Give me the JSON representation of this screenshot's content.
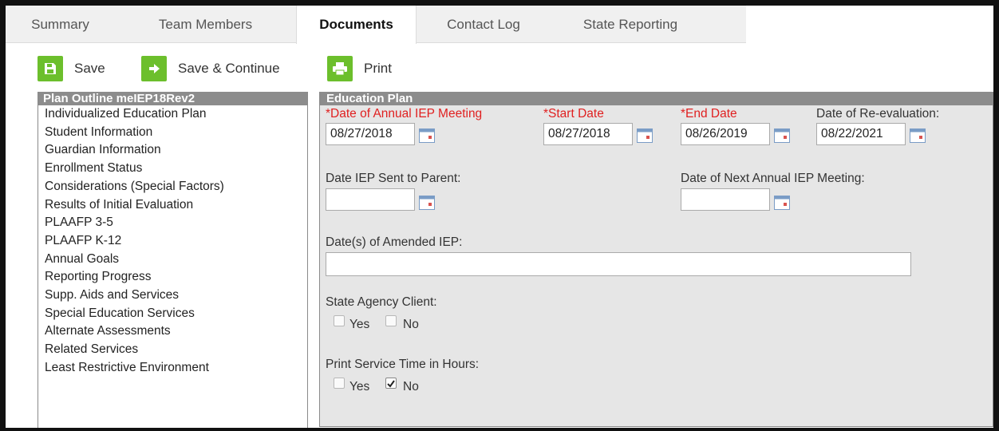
{
  "tabs": [
    {
      "label": "Summary"
    },
    {
      "label": "Team Members"
    },
    {
      "label": "Documents"
    },
    {
      "label": "Contact Log"
    },
    {
      "label": "State Reporting"
    }
  ],
  "active_tab": "Documents",
  "toolbar": {
    "save_label": "Save",
    "save_continue_label": "Save & Continue",
    "print_label": "Print"
  },
  "outline": {
    "title": "Plan Outline meIEP18Rev2",
    "items": [
      "Individualized Education Plan",
      "Student Information",
      "Guardian Information",
      "Enrollment Status",
      "Considerations (Special Factors)",
      "Results of Initial Evaluation",
      "PLAAFP 3-5",
      "PLAAFP K-12",
      "Annual Goals",
      "Reporting Progress",
      "Supp. Aids and Services",
      "Special Education Services",
      "Alternate Assessments",
      "Related Services",
      "Least Restrictive Environment"
    ]
  },
  "panel": {
    "title": "Education Plan",
    "meeting_date": {
      "label": "*Date of Annual IEP Meeting",
      "value": "08/27/2018"
    },
    "start_date": {
      "label": "*Start Date",
      "value": "08/27/2018"
    },
    "end_date": {
      "label": "*End Date",
      "value": "08/26/2019"
    },
    "reeval_date": {
      "label": "Date of Re-evaluation:",
      "value": "08/22/2021"
    },
    "sent_to_parent": {
      "label": "Date IEP Sent to Parent:",
      "value": ""
    },
    "next_annual": {
      "label": "Date of Next Annual IEP Meeting:",
      "value": ""
    },
    "amended": {
      "label": "Date(s) of Amended IEP:",
      "value": ""
    },
    "state_agency": {
      "label": "State Agency Client:",
      "yes_label": "Yes",
      "no_label": "No",
      "yes_checked": false,
      "no_checked": false
    },
    "print_hours": {
      "label": "Print Service Time in Hours:",
      "yes_label": "Yes",
      "no_label": "No",
      "yes_checked": false,
      "no_checked": true
    }
  },
  "colors": {
    "accent_green": "#6cbf2c",
    "required_red": "#e02020",
    "header_gray": "#8c8c8c",
    "panel_bg": "#e6e6e6"
  }
}
